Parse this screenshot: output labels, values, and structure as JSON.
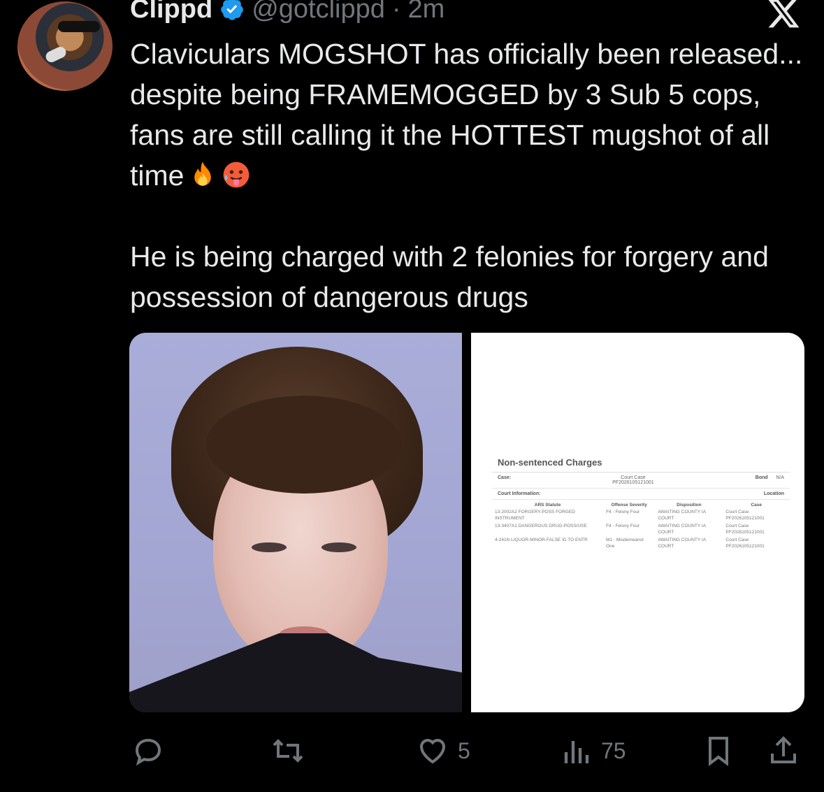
{
  "tweet": {
    "author_name": "Clippd",
    "handle": "@gotclippd",
    "separator": "·",
    "time": "2m",
    "text_line1": "Claviculars MOGSHOT has officially been released... despite being FRAMEMOGGED by 3 Sub 5 cops, fans are still calling it the HOTTEST mugshot of all time",
    "text_line2": "He is being charged with 2 felonies for forgery and possession of dangerous drugs",
    "emoji1": "fire-emoji",
    "emoji2": "hot-face-emoji"
  },
  "document": {
    "title": "Non-sentenced Charges",
    "case_label": "Case:",
    "court_case_label": "Court Case",
    "court_case_value": "PF2026105121001",
    "bond_label": "Bond",
    "bond_value": "N/A",
    "court_info_label": "Court Information:",
    "location_label": "Location",
    "headers": [
      "ARS Statute",
      "Offense Severity",
      "Disposition",
      "Case"
    ],
    "rows": [
      [
        "13-2002A2 FORGERY-POSS FORGED INSTRUMENT",
        "F4 - Felony Four",
        "AWAITING COUNTY IA COURT",
        "Court Case PF2026105121001"
      ],
      [
        "13-3407A1 DANGEROUS DRUG-POSS/USE",
        "F4 - Felony Four",
        "AWAITING COUNTY IA COURT",
        "Court Case PF2026105121001"
      ],
      [
        "4-241N LIQUOR-MINOR-FALSE ID TO ENTR",
        "M1 - Misdemeanor One",
        "AWAITING COUNTY IA COURT",
        "Court Case PF2026105121001"
      ]
    ]
  },
  "actions": {
    "reply_icon": "reply-icon",
    "retweet_icon": "retweet-icon",
    "like_icon": "heart-icon",
    "like_count": "5",
    "views_icon": "views-icon",
    "view_count": "75",
    "bookmark_icon": "bookmark-icon",
    "share_icon": "share-icon"
  },
  "colors": {
    "background": "#000000",
    "text": "#e7e9ea",
    "muted": "#71767b",
    "verified": "#1d9bf0"
  }
}
